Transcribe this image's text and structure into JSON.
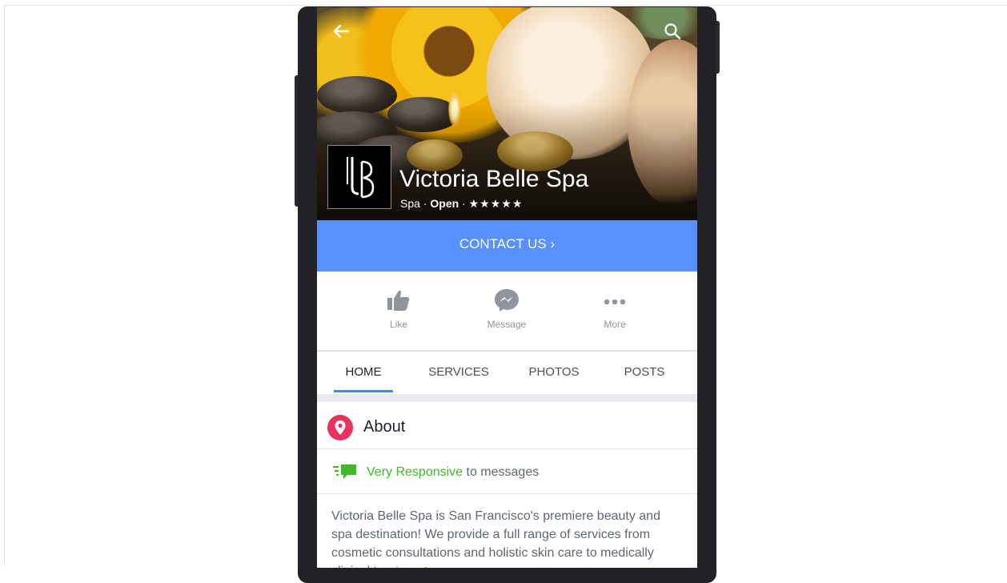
{
  "page": {
    "name": "Victoria Belle Spa",
    "category": "Spa",
    "separator": " · ",
    "status": "Open",
    "rating_stars": "★★★★★",
    "logo_text": "VB"
  },
  "contact_button": {
    "label": "CONTACT US ›"
  },
  "actions": [
    {
      "label": "Like",
      "icon": "thumbs-up-icon"
    },
    {
      "label": "Message",
      "icon": "messenger-icon"
    },
    {
      "label": "More",
      "icon": "more-dots-icon"
    }
  ],
  "tabs": [
    {
      "label": "HOME",
      "active": true
    },
    {
      "label": "SERVICES",
      "active": false
    },
    {
      "label": "PHOTOS",
      "active": false
    },
    {
      "label": "POSTS",
      "active": false
    }
  ],
  "about": {
    "title": "About",
    "responsive_highlight": "Very Responsive",
    "responsive_rest": " to messages",
    "description": "Victoria Belle Spa is San Francisco's premiere beauty and spa destination! We provide a full range of services from cosmetic consultations and holistic skin care to medically clinical treatments."
  },
  "colors": {
    "contact_blue": "#5890ff",
    "tab_indicator": "#4a86e8",
    "responsive_green": "#42b72a",
    "about_pin": "#e8335f"
  }
}
